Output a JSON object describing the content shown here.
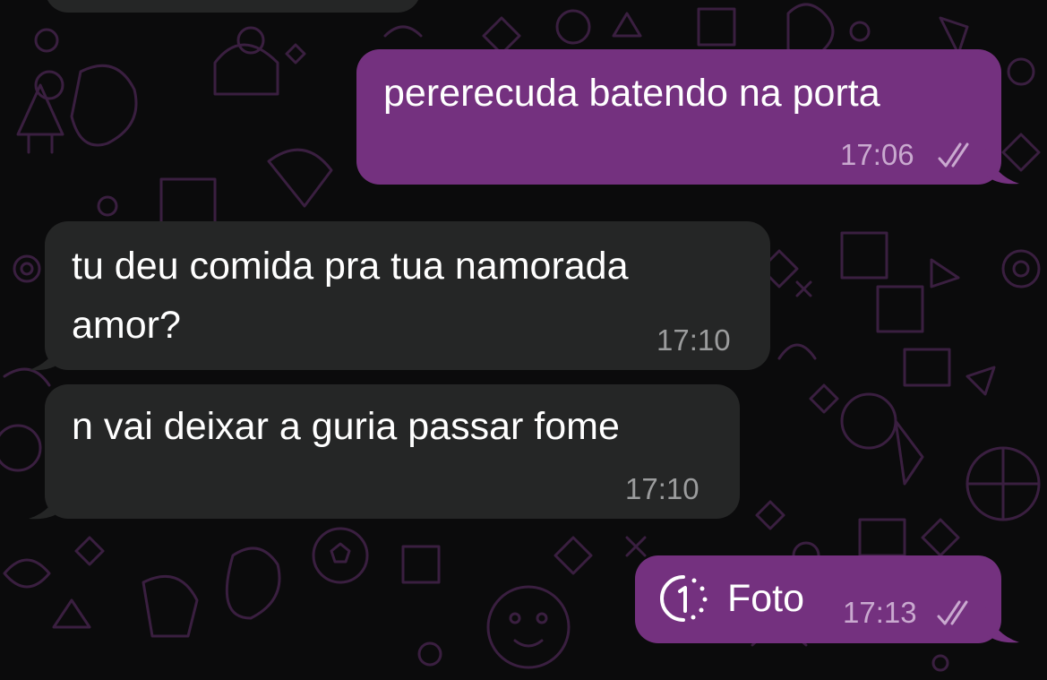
{
  "colors": {
    "background": "#0b0b0c",
    "outgoing_bubble": "#74317f",
    "incoming_bubble": "#252626",
    "outgoing_time": "#c9a9cf",
    "incoming_time": "#9b9c9d",
    "wallpaper_doodle": "#3a1f40"
  },
  "messages": [
    {
      "direction": "outgoing",
      "text": "pererecuda batendo na porta",
      "time": "17:06",
      "status": "read-double-check"
    },
    {
      "direction": "incoming",
      "text_line1": "tu deu comida pra tua namorada",
      "text_line2": "amor?",
      "time": "17:10"
    },
    {
      "direction": "incoming",
      "text": "n vai deixar a guria passar fome",
      "time": "17:10"
    },
    {
      "direction": "outgoing",
      "type": "view-once-photo",
      "text": "Foto",
      "time": "17:13",
      "status": "read-double-check",
      "icon": "view-once-icon"
    }
  ]
}
